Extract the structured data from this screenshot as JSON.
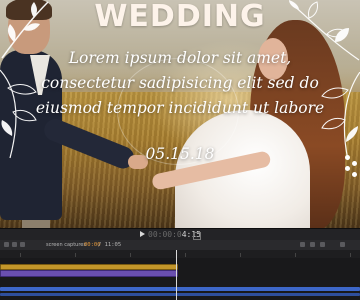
{
  "preview": {
    "title": "WEDDING",
    "body": "Lorem ipsum dolor sit amet, consectetur sadipisicing elit sed do eiusmod tempor incididunt ut labore",
    "date": "05.15.18"
  },
  "transport": {
    "timecode_dim": "00:00:0",
    "timecode_bright": "4:15"
  },
  "toolbar": {
    "label": "screen captures",
    "timecode": "00:00",
    "timecode_total": "/ 11:05"
  },
  "colors": {
    "accent_orange": "#e79a3c",
    "clip_gold": "#c3962a",
    "clip_purple": "#6a4fb0",
    "clip_blue": "#3d67c9"
  }
}
